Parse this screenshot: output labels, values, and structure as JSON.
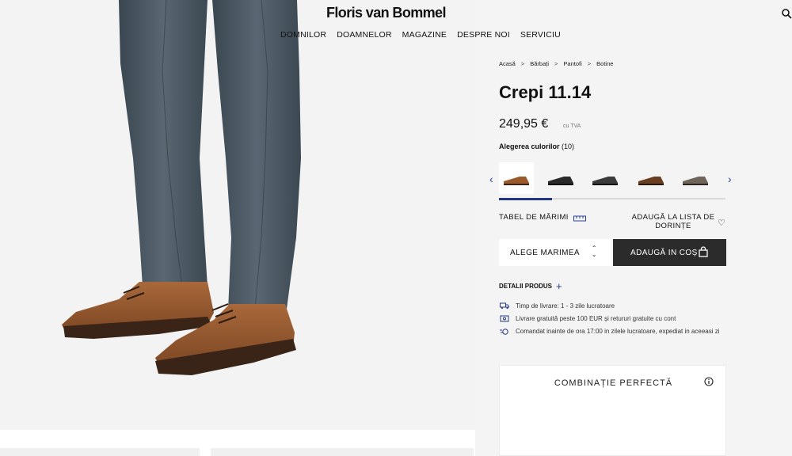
{
  "header": {
    "logo": "Floris van Bommel",
    "search_icon": "search-icon",
    "nav": [
      "DOMNILOR",
      "DOAMNELOR",
      "MAGAZINE",
      "DESPRE NOI",
      "SERVICIU"
    ]
  },
  "breadcrumb": [
    "Acasă",
    "Bărbați",
    "Pantofi",
    "Botine"
  ],
  "product": {
    "title": "Crepi 11.14",
    "price": "249,95 €",
    "vat": "cu TVA",
    "color_label": "Alegerea culorilor",
    "color_count": "(10)",
    "swatches": [
      {
        "name": "cognac",
        "color": "#9a5a2c"
      },
      {
        "name": "black",
        "color": "#2a2a2a"
      },
      {
        "name": "dark-grey",
        "color": "#3b3b3b"
      },
      {
        "name": "brown",
        "color": "#6a3e22"
      },
      {
        "name": "grey-brown",
        "color": "#6f655b"
      }
    ],
    "size_table": "TABEL DE MĂRIMI",
    "wishlist": "ADAUGĂ LA LISTA DE DORINȚE",
    "size_select": "ALEGE MARIMEA",
    "add_to_cart": "ADAUGĂ IN COȘ",
    "details": "DETALII PRODUS",
    "info": [
      "Timp de livrare: 1 - 3 zile lucratoare",
      "Livrare gratuită peste 100 EUR și retururi gratuite cu cont",
      "Comandat inainte de ora 17:00 in zilele lucratoare, expediat in aceeasi zi"
    ]
  },
  "combo": {
    "title": "COMBINAȚIE PERFECTĂ"
  },
  "colors": {
    "accent": "#233880",
    "cart_bg": "#2b2b2b"
  }
}
